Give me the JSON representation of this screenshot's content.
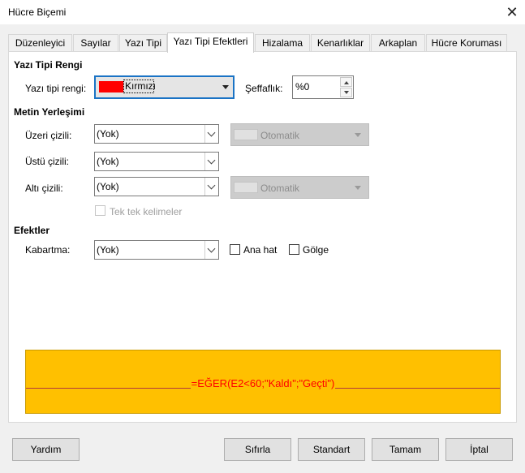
{
  "window": {
    "title": "Hücre Biçemi"
  },
  "tabs": [
    {
      "label": "Düzenleyici"
    },
    {
      "label": "Sayılar"
    },
    {
      "label": "Yazı Tipi"
    },
    {
      "label": "Yazı Tipi Efektleri",
      "active": true
    },
    {
      "label": "Hizalama"
    },
    {
      "label": "Kenarlıklar"
    },
    {
      "label": "Arkaplan"
    },
    {
      "label": "Hücre Koruması"
    }
  ],
  "font_color": {
    "heading": "Yazı Tipi Rengi",
    "label": "Yazı tipi rengi:",
    "value": "Kırmızı",
    "swatch": "#ff0000",
    "transparency_label": "Şeffaflık:",
    "transparency_value": "%0"
  },
  "text_decoration": {
    "heading": "Metin Yerleşimi",
    "overline": {
      "label": "Üzeri çizili:",
      "value": "(Yok)",
      "color": "Otomatik"
    },
    "strikethrough": {
      "label": "Üstü çizili:",
      "value": "(Yok)"
    },
    "underline": {
      "label": "Altı çizili:",
      "value": "(Yok)",
      "color": "Otomatik"
    },
    "individual_words": {
      "label": "Tek tek kelimeler",
      "checked": false,
      "enabled": false
    }
  },
  "effects": {
    "heading": "Efektler",
    "relief": {
      "label": "Kabartma:",
      "value": "(Yok)"
    },
    "outline": {
      "label": "Ana hat",
      "checked": false
    },
    "shadow": {
      "label": "Gölge",
      "checked": false
    }
  },
  "preview": {
    "text": "=EĞER(E2<60;\"Kaldı\";\"Geçti\")",
    "background": "#ffc000",
    "text_color": "#ff0000"
  },
  "buttons": {
    "help": "Yardım",
    "reset": "Sıfırla",
    "standard": "Standart",
    "ok": "Tamam",
    "cancel": "İptal"
  }
}
